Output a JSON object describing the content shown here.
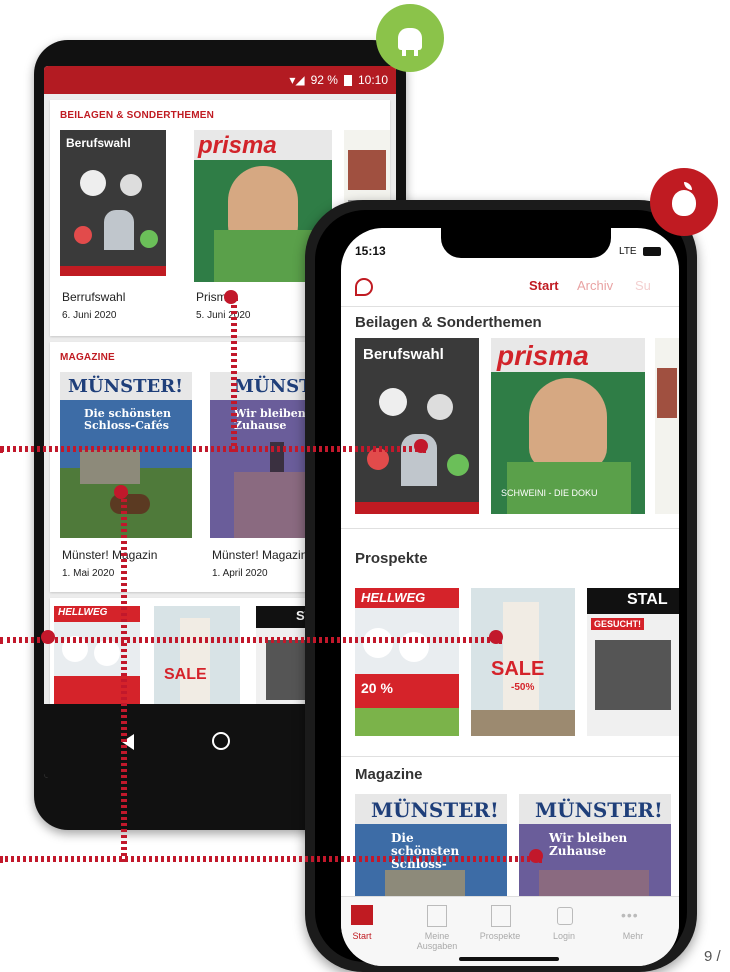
{
  "android": {
    "status": {
      "battery": "92 %",
      "time": "10:10"
    },
    "sections": {
      "beilagen": "BEILAGEN & SONDERTHEMEN",
      "magazine": "MAGAZINE"
    },
    "beilagen_items": [
      {
        "title": "Berrufswahl",
        "date": "6. Juni 2020",
        "cover_title": "Berufswahl"
      },
      {
        "title": "Prisma",
        "date": "5. Juni 2020",
        "cover_title": "prisma"
      }
    ],
    "magazine_items": [
      {
        "title": "Münster! Magazin",
        "date": "1. Mai 2020",
        "cover_title": "MÜNSTER!",
        "headline": "Die schönsten Schloss-Cafés"
      },
      {
        "title": "Münster! Magazin",
        "date": "1. April 2020",
        "cover_title": "MÜNSTER!",
        "headline": "Wir bleiben Zuhause"
      }
    ],
    "prospekte_covers": [
      "HELLWEG",
      "SALE",
      "STAL"
    ]
  },
  "ios": {
    "status": {
      "time": "15:13",
      "network": "LTE"
    },
    "tabs_top": [
      "Start",
      "Archiv",
      "Su"
    ],
    "sections": [
      "Beilagen & Sonderthemen",
      "Prospekte",
      "Magazine"
    ],
    "beilagen_covers": [
      "Berufswahl",
      "prisma"
    ],
    "prisma_caption": "SCHWEINI - DIE DOKU",
    "prospekte_covers": {
      "hellweg": "HELLWEG",
      "hellweg_sub": "20 %",
      "sale": "SALE",
      "sale_sub": "-50%",
      "stal": "STAL",
      "gesucht": "GESUCHT!"
    },
    "magazine_covers": [
      {
        "title": "MÜNSTER!",
        "headline": "Die schönsten Schloss-Cafés"
      },
      {
        "title": "MÜNSTER!",
        "headline": "Wir bleiben Zuhause"
      }
    ],
    "bottom_tabs": [
      "Start",
      "Meine Ausgaben",
      "Prospekte",
      "Login",
      "Mehr"
    ]
  },
  "page_number": "9 /",
  "colors": {
    "brand_red": "#c01b22",
    "android_green": "#8bc34a"
  }
}
